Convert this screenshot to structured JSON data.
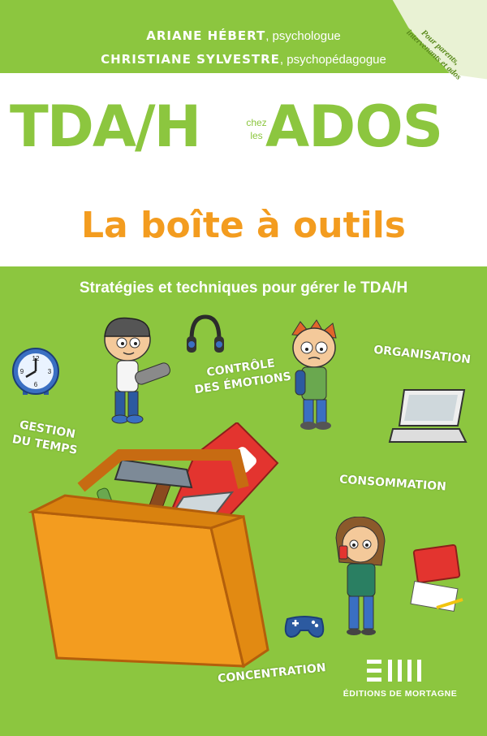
{
  "authors": [
    {
      "name": "ARIANE HÉBERT",
      "role": ", psychologue"
    },
    {
      "name": "CHRISTIANE SYLVESTRE",
      "role": ", psychopédagogue"
    }
  ],
  "corner_banner": {
    "line1": "Pour parents,",
    "line2": "intervenants et ados"
  },
  "title": {
    "left": "TDA/H",
    "chez": "chez",
    "les": "les",
    "right": "ADOS"
  },
  "subtitle": "La boîte à outils",
  "tagline": "Stratégies et techniques pour gérer le TDA/H",
  "topics": {
    "organisation": "ORGANISATION",
    "controle_1": "CONTRÔLE",
    "controle_2": "DES ÉMOTIONS",
    "gestion_1": "GESTION",
    "gestion_2": "DU TEMPS",
    "consommation": "CONSOMMATION",
    "concentration": "CONCENTRATION"
  },
  "publisher": {
    "name": "ÉDITIONS DE MORTAGNE"
  },
  "clock_numbers": [
    "12",
    "3",
    "6",
    "9"
  ],
  "colors": {
    "green": "#8cc63f",
    "orange": "#f39c1f",
    "white": "#ffffff"
  },
  "icons": [
    "clock-icon",
    "headphones-icon",
    "laptop-icon",
    "toolbox-icon",
    "hammer-icon",
    "saw-icon",
    "screwdriver-icon",
    "game-controller-icon",
    "notebook-icon",
    "publisher-logo"
  ]
}
